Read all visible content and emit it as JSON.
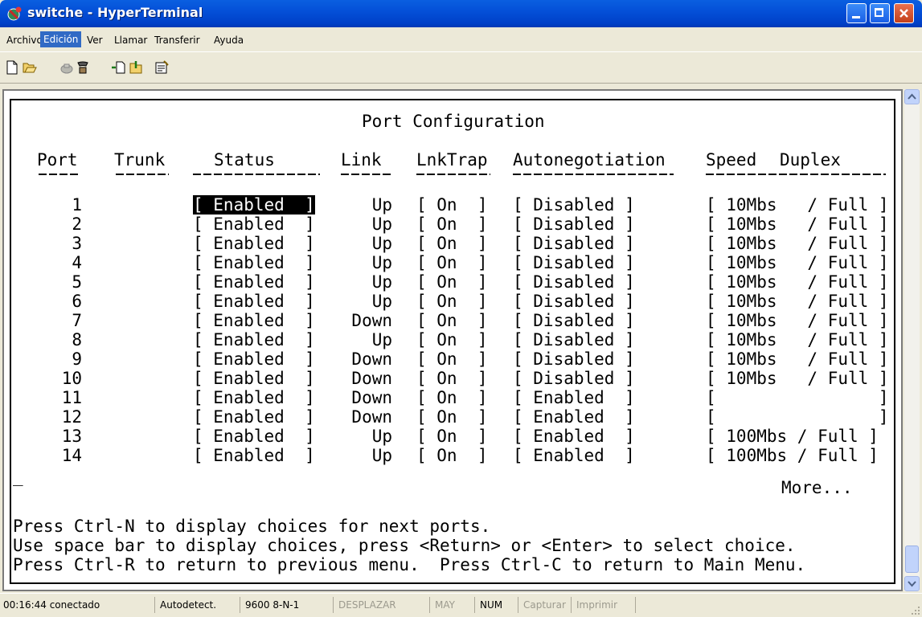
{
  "window": {
    "title": "switche - HyperTerminal"
  },
  "menu": [
    "Archivo",
    "Edición",
    "Ver",
    "Llamar",
    "Transferir",
    "Ayuda"
  ],
  "toolbar_icons": [
    "new-icon",
    "open-icon",
    "disconnect-icon",
    "call-icon",
    "send-icon",
    "receive-icon",
    "properties-icon"
  ],
  "terminal": {
    "heading": "Port Configuration",
    "columns": [
      "Port",
      "Trunk",
      "Status",
      "Link",
      "LnkTrap",
      "Autonegotiation",
      "Speed",
      "Duplex"
    ],
    "selected_status": "[ Enabled  ]",
    "rows": [
      {
        "port": "1",
        "status": "[ Enabled  ]",
        "link": "Up",
        "trap": "[ On  ]",
        "auto": "[ Disabled ]",
        "speed": "[ 10Mbs   / Full ]"
      },
      {
        "port": "2",
        "status": "[ Enabled  ]",
        "link": "Up",
        "trap": "[ On  ]",
        "auto": "[ Disabled ]",
        "speed": "[ 10Mbs   / Full ]"
      },
      {
        "port": "3",
        "status": "[ Enabled  ]",
        "link": "Up",
        "trap": "[ On  ]",
        "auto": "[ Disabled ]",
        "speed": "[ 10Mbs   / Full ]"
      },
      {
        "port": "4",
        "status": "[ Enabled  ]",
        "link": "Up",
        "trap": "[ On  ]",
        "auto": "[ Disabled ]",
        "speed": "[ 10Mbs   / Full ]"
      },
      {
        "port": "5",
        "status": "[ Enabled  ]",
        "link": "Up",
        "trap": "[ On  ]",
        "auto": "[ Disabled ]",
        "speed": "[ 10Mbs   / Full ]"
      },
      {
        "port": "6",
        "status": "[ Enabled  ]",
        "link": "Up",
        "trap": "[ On  ]",
        "auto": "[ Disabled ]",
        "speed": "[ 10Mbs   / Full ]"
      },
      {
        "port": "7",
        "status": "[ Enabled  ]",
        "link": "Down",
        "trap": "[ On  ]",
        "auto": "[ Disabled ]",
        "speed": "[ 10Mbs   / Full ]"
      },
      {
        "port": "8",
        "status": "[ Enabled  ]",
        "link": "Up",
        "trap": "[ On  ]",
        "auto": "[ Disabled ]",
        "speed": "[ 10Mbs   / Full ]"
      },
      {
        "port": "9",
        "status": "[ Enabled  ]",
        "link": "Down",
        "trap": "[ On  ]",
        "auto": "[ Disabled ]",
        "speed": "[ 10Mbs   / Full ]"
      },
      {
        "port": "10",
        "status": "[ Enabled  ]",
        "link": "Down",
        "trap": "[ On  ]",
        "auto": "[ Disabled ]",
        "speed": "[ 10Mbs   / Full ]"
      },
      {
        "port": "11",
        "status": "[ Enabled  ]",
        "link": "Down",
        "trap": "[ On  ]",
        "auto": "[ Enabled  ]",
        "speed": "[                ]"
      },
      {
        "port": "12",
        "status": "[ Enabled  ]",
        "link": "Down",
        "trap": "[ On  ]",
        "auto": "[ Enabled  ]",
        "speed": "[                ]"
      },
      {
        "port": "13",
        "status": "[ Enabled  ]",
        "link": "Up",
        "trap": "[ On  ]",
        "auto": "[ Enabled  ]",
        "speed": "[ 100Mbs / Full ]"
      },
      {
        "port": "14",
        "status": "[ Enabled  ]",
        "link": "Up",
        "trap": "[ On  ]",
        "auto": "[ Enabled  ]",
        "speed": "[ 100Mbs / Full ]"
      }
    ],
    "cursor": "_",
    "more": "More...",
    "help_lines": [
      "Press Ctrl-N to display choices for next ports.",
      "Use space bar to display choices, press <Return> or <Enter> to select choice.",
      "Press Ctrl-R to return to previous menu.  Press Ctrl-C to return to Main Menu."
    ]
  },
  "status": {
    "connected": "00:16:44 conectado",
    "detect": "Autodetect.",
    "settings": "9600 8-N-1",
    "scroll": "DESPLAZAR",
    "caps": "MAY",
    "num": "NUM",
    "capture": "Capturar",
    "print": "Imprimir"
  }
}
